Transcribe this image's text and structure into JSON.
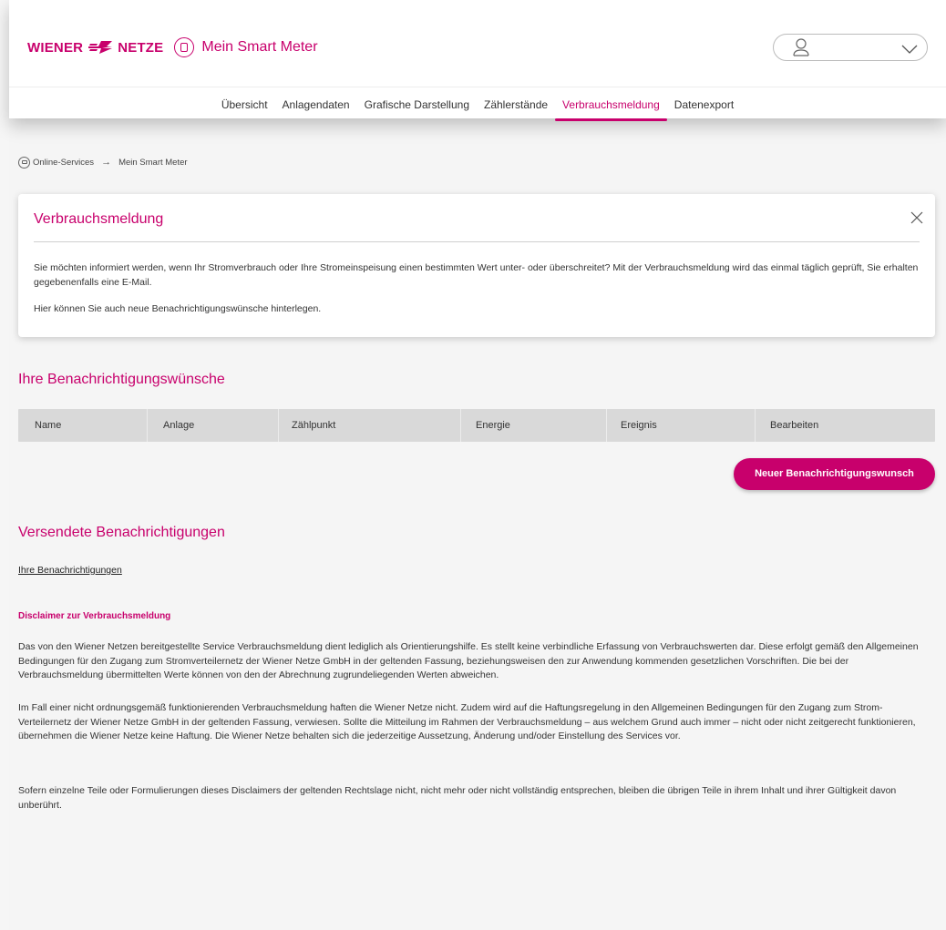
{
  "brand": {
    "wordmark_left": "WIENER",
    "wordmark_right": "NETZE",
    "app_title": "Mein Smart Meter",
    "accent_color": "#c8006c"
  },
  "nav": {
    "items": [
      {
        "label": "Übersicht"
      },
      {
        "label": "Anlagendaten"
      },
      {
        "label": "Grafische Darstellung"
      },
      {
        "label": "Zählerstände"
      },
      {
        "label": "Verbrauchsmeldung",
        "active": true
      },
      {
        "label": "Datenexport"
      }
    ]
  },
  "breadcrumb": {
    "root": "Online-Services",
    "current": "Mein Smart Meter"
  },
  "info_card": {
    "title": "Verbrauchsmeldung",
    "text1": "Sie möchten informiert werden, wenn Ihr Stromverbrauch oder Ihre Stromeinspeisung einen bestimmten Wert unter- oder überschreitet? Mit der Verbrauchsmeldung wird das einmal täglich geprüft, Sie erhalten gegebenenfalls eine E-Mail.",
    "text2": "Hier können Sie auch neue Benachrichtigungswünsche hinterlegen."
  },
  "wishes": {
    "title": "Ihre Benachrichtigungswünsche",
    "columns": [
      "Name",
      "Anlage",
      "Zählpunkt",
      "Energie",
      "Ereignis",
      "Bearbeiten"
    ],
    "rows": [],
    "new_button": "Neuer Benachrichtigungswunsch"
  },
  "sent": {
    "title": "Versendete Benachrichtigungen",
    "link": "Ihre Benachrichtigungen"
  },
  "disclaimer": {
    "title": "Disclaimer zur Verbrauchsmeldung",
    "p1": "Das von den Wiener Netzen bereitgestellte Service Verbrauchsmeldung dient lediglich als Orientierungshilfe. Es stellt keine verbindliche Erfassung von Verbrauchswerten dar. Diese erfolgt gemäß den Allgemeinen Bedingungen für den Zugang zum Stromverteilernetz der Wiener Netze GmbH in der geltenden Fassung, beziehungsweisen den zur Anwendung kommenden gesetzlichen Vorschriften. Die bei der Verbrauchsmeldung übermittelten Werte können von den der Abrechnung zugrundeliegenden Werten abweichen.",
    "p2": "Im Fall einer nicht ordnungsgemäß funktionierenden Verbrauchsmeldung haften die Wiener Netze nicht. Zudem wird auf die Haftungsregelung in den Allgemeinen Bedingungen für den Zugang zum Strom- Verteilernetz der Wiener Netze GmbH in der geltenden Fassung, verwiesen. Sollte die Mitteilung im Rahmen der Verbrauchsmeldung – aus welchem Grund auch immer – nicht oder nicht zeitgerecht funktionieren, übernehmen die Wiener Netze keine Haftung. Die Wiener Netze behalten sich die jederzeitige Aussetzung, Änderung und/oder Einstellung des Services vor.",
    "p3": "Sofern einzelne Teile oder Formulierungen dieses Disclaimers der geltenden Rechtslage nicht, nicht mehr oder nicht vollständig entsprechen, bleiben die übrigen Teile in ihrem Inhalt und ihrer Gültigkeit davon unberührt."
  }
}
